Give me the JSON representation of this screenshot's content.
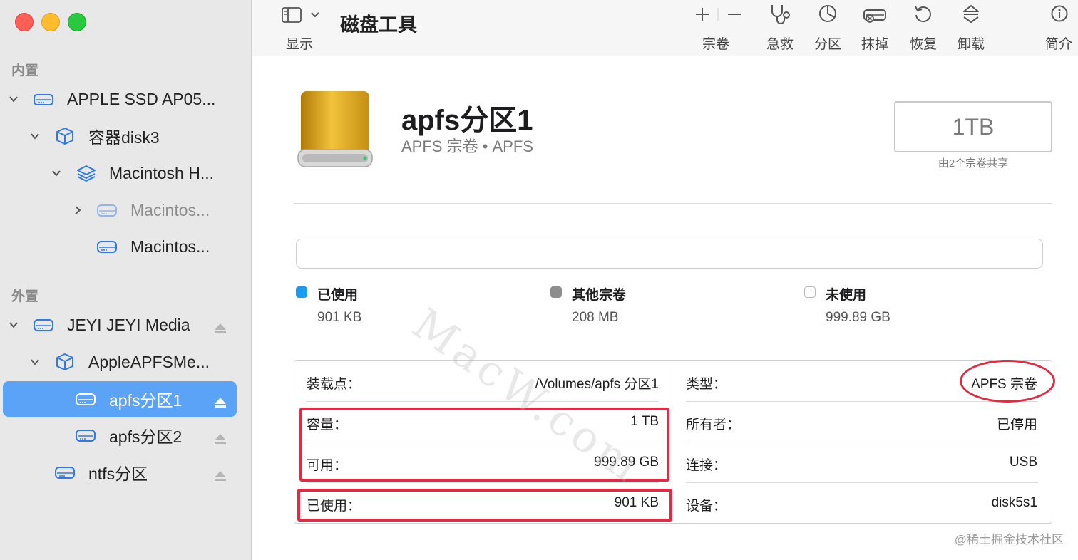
{
  "window": {
    "controls": [
      "close",
      "minimize",
      "zoom"
    ]
  },
  "sidebar": {
    "sections": [
      {
        "label": "内置"
      },
      {
        "label": "外置"
      }
    ],
    "internal": [
      {
        "label": "APPLE SSD AP05...",
        "icon": "internal-drive-icon",
        "expanded": true
      },
      {
        "label": "容器disk3",
        "icon": "container-cube-icon",
        "expanded": true
      },
      {
        "label": "Macintosh H...",
        "icon": "layers-icon",
        "expanded": true
      },
      {
        "label": "Macintos...",
        "icon": "volume-drive-icon",
        "expanded": false,
        "dimmed": true
      },
      {
        "label": "Macintos...",
        "icon": "volume-drive-icon"
      }
    ],
    "external": [
      {
        "label": "JEYI JEYI Media",
        "icon": "external-drive-icon",
        "expanded": true
      },
      {
        "label": "AppleAPFSMe...",
        "icon": "container-cube-icon",
        "expanded": true
      },
      {
        "label": "apfs分区1",
        "icon": "volume-drive-icon",
        "selected": true
      },
      {
        "label": "apfs分区2",
        "icon": "volume-drive-icon"
      },
      {
        "label": "ntfs分区",
        "icon": "volume-drive-icon"
      }
    ]
  },
  "toolbar": {
    "view_label": "显示",
    "app_title": "磁盘工具",
    "add_remove_label": "宗卷",
    "first_aid_label": "急救",
    "partition_label": "分区",
    "erase_label": "抹掉",
    "restore_label": "恢复",
    "unmount_label": "卸载",
    "info_label": "简介"
  },
  "volume": {
    "name": "apfs分区1",
    "subtitle": "APFS 宗卷 • APFS",
    "capacity": "1TB",
    "shared_note": "由2个宗卷共享"
  },
  "usage": {
    "legend": [
      {
        "name": "已使用",
        "value": "901 KB",
        "color": "#1a9bf0"
      },
      {
        "name": "其他宗卷",
        "value": "208 MB",
        "color": "#8e8e8e"
      },
      {
        "name": "未使用",
        "value": "999.89 GB",
        "color": "#ffffff"
      }
    ]
  },
  "info": {
    "left": [
      {
        "key": "装载点：",
        "value": "/Volumes/apfs 分区1"
      },
      {
        "key": "容量：",
        "value": "1 TB"
      },
      {
        "key": "可用：",
        "value": "999.89 GB"
      },
      {
        "key": "已使用：",
        "value": "901 KB"
      }
    ],
    "right": [
      {
        "key": "类型：",
        "value": "APFS 宗卷"
      },
      {
        "key": "所有者：",
        "value": "已停用"
      },
      {
        "key": "连接：",
        "value": "USB"
      },
      {
        "key": "设备：",
        "value": "disk5s1"
      }
    ]
  },
  "watermark": "MacW.com",
  "credit": "@稀土掘金技术社区",
  "colors": {
    "accent": "#5ba3f7",
    "annotation": "#dc2d44",
    "used": "#1a9bf0",
    "other": "#8e8e8e"
  }
}
